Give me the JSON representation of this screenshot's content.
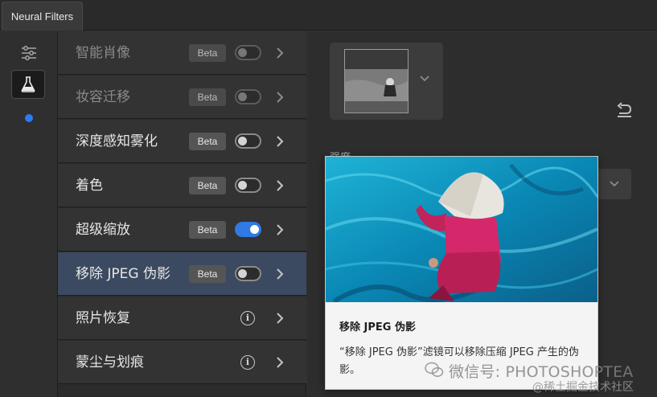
{
  "window": {
    "tab_title": "Neural Filters"
  },
  "rail": {
    "icons": [
      "settings-sliders-icon",
      "flask-icon"
    ],
    "dot_color": "#2b7cf0"
  },
  "filters": [
    {
      "label": "智能肖像",
      "badge": "Beta",
      "control": "toggle",
      "on": false,
      "dimmed": true,
      "selected": false
    },
    {
      "label": "妆容迁移",
      "badge": "Beta",
      "control": "toggle",
      "on": false,
      "dimmed": true,
      "selected": false
    },
    {
      "label": "深度感知雾化",
      "badge": "Beta",
      "control": "toggle",
      "on": false,
      "dimmed": false,
      "selected": false
    },
    {
      "label": "着色",
      "badge": "Beta",
      "control": "toggle",
      "on": false,
      "dimmed": false,
      "selected": false
    },
    {
      "label": "超级缩放",
      "badge": "Beta",
      "control": "toggle",
      "on": true,
      "dimmed": false,
      "selected": false
    },
    {
      "label": "移除 JPEG 伪影",
      "badge": "Beta",
      "control": "toggle",
      "on": false,
      "dimmed": false,
      "selected": true
    },
    {
      "label": "照片恢复",
      "badge": "",
      "control": "info",
      "info_glyph": "i",
      "dimmed": false,
      "selected": false
    },
    {
      "label": "蒙尘与划痕",
      "badge": "",
      "control": "info",
      "info_glyph": "i",
      "dimmed": false,
      "selected": false
    }
  ],
  "panel": {
    "strength_label": "强度",
    "undo_icon": "undo-icon"
  },
  "tooltip": {
    "title": "移除 JPEG 伪影",
    "description": "“移除 JPEG 伪影”滤镜可以移除压缩 JPEG 产生的伪影。"
  },
  "watermark": {
    "text": "微信号: PHOTOSHOPTEA",
    "secondary": "@稀土掘金技术社区"
  },
  "colors": {
    "accent": "#2f7ae5",
    "selected_row": "#3b4a60",
    "tooltip_bg": "#f4f4f4"
  }
}
